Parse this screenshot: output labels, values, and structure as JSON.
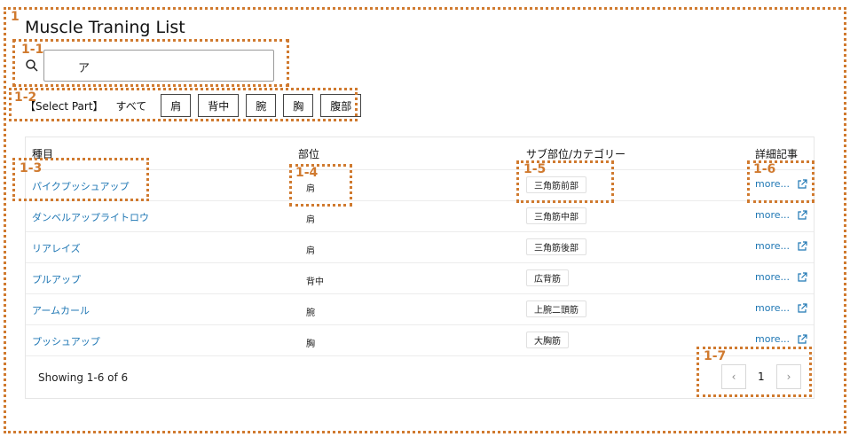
{
  "app": {
    "title": "Muscle Traning List"
  },
  "search": {
    "value": "ア",
    "icon": "search-icon"
  },
  "filter": {
    "label": "【Select Part】",
    "all": "すべて",
    "parts": [
      "肩",
      "背中",
      "腕",
      "胸",
      "腹部"
    ]
  },
  "table": {
    "headers": [
      "種目",
      "部位",
      "サブ部位/カテゴリー",
      "詳細記事"
    ],
    "rows": [
      {
        "name": "パイクプッシュアップ",
        "part": "肩",
        "sub": "三角筋前部",
        "more": "more..."
      },
      {
        "name": "ダンベルアップライトロウ",
        "part": "肩",
        "sub": "三角筋中部",
        "more": "more..."
      },
      {
        "name": "リアレイズ",
        "part": "肩",
        "sub": "三角筋後部",
        "more": "more..."
      },
      {
        "name": "プルアップ",
        "part": "背中",
        "sub": "広背筋",
        "more": "more..."
      },
      {
        "name": "アームカール",
        "part": "腕",
        "sub": "上腕二頭筋",
        "more": "more..."
      },
      {
        "name": "プッシュアップ",
        "part": "胸",
        "sub": "大胸筋",
        "more": "more..."
      }
    ]
  },
  "pagination": {
    "showing": "Showing 1-6 of 6",
    "current_page": "1",
    "prev": "‹",
    "next": "›"
  },
  "annotations": {
    "labels": [
      "1",
      "1-1",
      "1-2",
      "1-3",
      "1-4",
      "1-5",
      "1-6",
      "1-7"
    ],
    "color": "#d07a2f"
  },
  "colors": {
    "link": "#1f77b4"
  }
}
